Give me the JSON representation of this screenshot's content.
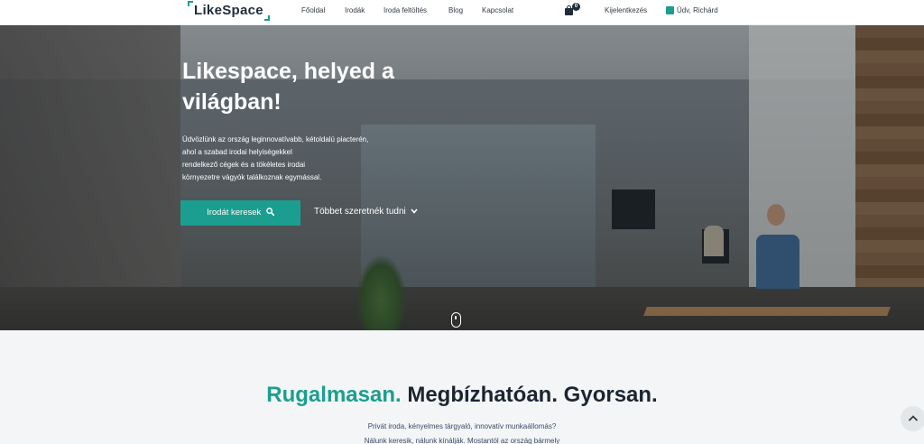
{
  "brand": {
    "logo_text": "LikeSpace",
    "accent_color": "#1b9e8f",
    "dark_color": "#1f2d3a"
  },
  "nav": {
    "items": [
      "Főoldal",
      "Irodák",
      "Iroda feltöltés",
      "Blog",
      "Kapcsolat"
    ],
    "cart_count": "0",
    "logout": "Kijelentkezés",
    "greeting": "Üdv, Richárd"
  },
  "hero": {
    "title_line1": "Likespace, helyed a",
    "title_line2": "világban!",
    "desc_lines": [
      "Üdvözlünk az ország leginnovatívabb, kétoldalú piacterén,",
      "ahol a szabad irodai helyiségekkel",
      "rendelkező cégek és a tökéletes irodai",
      "környezetre vágyók találkoznak egymással."
    ],
    "search_button": "Irodát keresek",
    "more_button": "Többet szeretnék tudni"
  },
  "section": {
    "headline_accent": "Rugalmasan.",
    "headline_rest": " Megbízhatóan. Gyorsan.",
    "sub_line1": "Privát iroda, kényelmes tárgyaló, innovatív munkaállomás?",
    "sub_line2": "Nálunk keresik, nálunk kínálják. Mostantól az ország bármely"
  },
  "icons": [
    "search-icon",
    "chevron-down-icon",
    "shopping-bag-icon",
    "mouse-scroll-icon",
    "chevron-up-icon",
    "user-icon"
  ]
}
